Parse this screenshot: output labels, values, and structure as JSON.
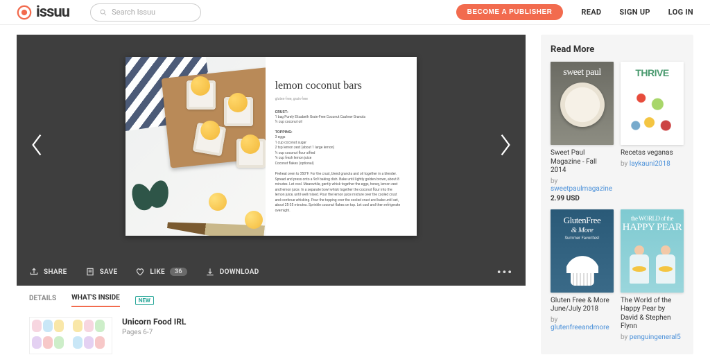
{
  "header": {
    "brand": "issuu",
    "search_placeholder": "Search Issuu",
    "cta": "BECOME A PUBLISHER",
    "nav": {
      "read": "READ",
      "signup": "SIGN UP",
      "login": "LOG IN"
    }
  },
  "reader": {
    "spread": {
      "recipe_title": "lemon coconut bars",
      "recipe_sub": "gluten-free, grain-free",
      "crust_h": "CRUST:",
      "crust_body": "1 bag Purely Elizabeth Grain-Free Coconut Cashew Granola\n½ cup coconut oil",
      "topping_h": "TOPPING:",
      "topping_body": "3 eggs\n1 cup coconut sugar\n2 tsp lemon zest (about 1 large lemon)\n½ cup coconut flour sifted\n¾ cup fresh lemon juice\nCoconut flakes (optional)",
      "method": "Preheat oven to 350°F. For the crust, blend granola and oil together in a blender. Spread and press onto a 9x9 baking dish. Bake until lightly golden brown, about 8 minutes. Let cool. Meanwhile, gently whisk together the eggs, honey, lemon zest and lemon juice. In a separate bowl whisk together the coconut flour into the lemon juice, until well mixed. Pour the lemon juice mixture over the cooled crust and continue whisking. Pour the topping over the cooled crust and bake until set, about 25-35 minutes. Sprinkle coconut flakes on top. Let cool and then refrigerate overnight."
    }
  },
  "actions": {
    "share": "SHARE",
    "save": "SAVE",
    "like": "LIKE",
    "like_count": "36",
    "download": "DOWNLOAD"
  },
  "tabs": {
    "details": "DETAILS",
    "whats_inside": "WHAT'S INSIDE",
    "new_badge": "NEW"
  },
  "inside": {
    "title": "Unicorn Food IRL",
    "pages": "Pages 6-7"
  },
  "sidebar": {
    "heading": "Read More",
    "items": [
      {
        "cover_label": "sweet paul",
        "title": "Sweet Paul Magazine - Fall 2014",
        "by_prefix": "by ",
        "author": "sweetpaulmagazine",
        "price": "2.99 USD"
      },
      {
        "cover_label": "THRIVE",
        "title": "Recetas veganas",
        "by_prefix": "by ",
        "author": "laykauni2018",
        "price": ""
      },
      {
        "cover_label": "GlutenFree",
        "cover_label2": "& More",
        "cover_sub": "Summer Favorites!",
        "title": "Gluten Free & More June/July 2018",
        "by_prefix": "by ",
        "author": "glutenfreeandmore",
        "price": ""
      },
      {
        "cover_label_pre": "the WORLD of the",
        "cover_label": "HAPPY PEAR",
        "title": "The World of the Happy Pear by David & Stephen Flynn",
        "by_prefix": "by ",
        "author": "penguingeneral5",
        "price": ""
      }
    ]
  }
}
